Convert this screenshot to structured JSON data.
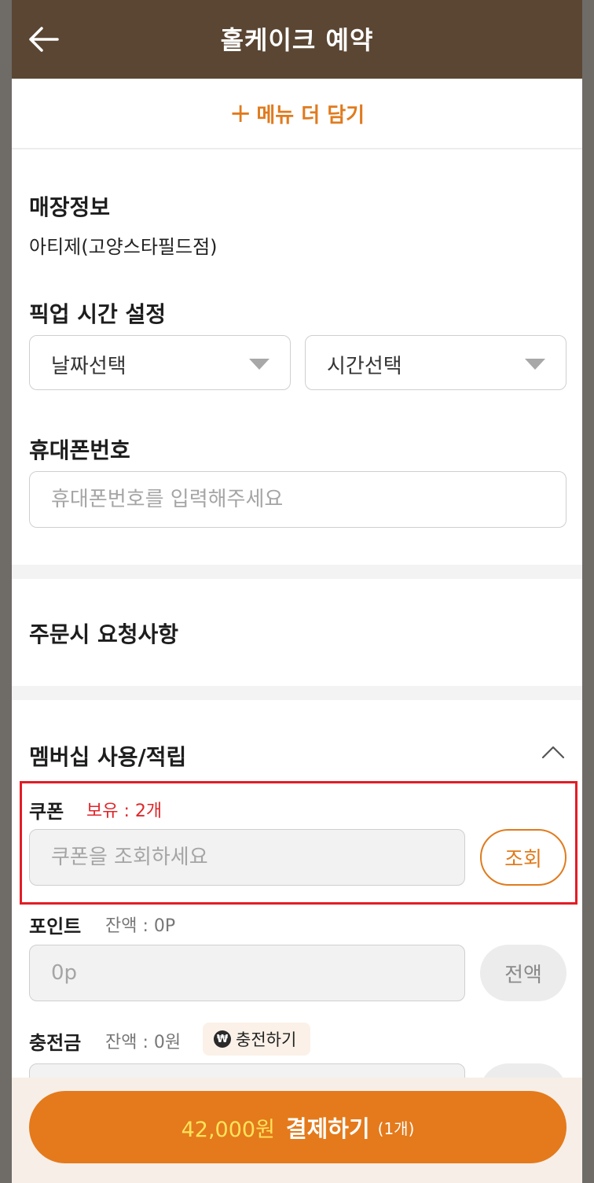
{
  "header": {
    "title": "홀케이크 예약"
  },
  "add_more": {
    "label": "메뉴 더 담기"
  },
  "store": {
    "title": "매장정보",
    "name": "아티제(고양스타필드점)"
  },
  "pickup": {
    "title": "픽업 시간 설정",
    "date_label": "날짜선택",
    "time_label": "시간선택"
  },
  "phone": {
    "title": "휴대폰번호",
    "placeholder": "휴대폰번호를 입력해주세요"
  },
  "request": {
    "title": "주문시 요청사항"
  },
  "membership": {
    "title": "멤버십 사용/적립"
  },
  "coupon": {
    "label": "쿠폰",
    "holding": "보유 : 2개",
    "placeholder": "쿠폰을 조회하세요",
    "button": "조회"
  },
  "point": {
    "label": "포인트",
    "balance": "잔액 : 0P",
    "placeholder": "0p",
    "button": "전액"
  },
  "charge": {
    "label": "충전금",
    "balance": "잔액 : 0원",
    "chip": "충전하기",
    "chip_icon_glyph": "₩"
  },
  "payment": {
    "amount": "42,000원",
    "action": "결제하기",
    "count": "(1개)"
  },
  "colors": {
    "brand_brown": "#5a4633",
    "accent_orange": "#e47a1b",
    "highlight_red": "#e21d25"
  }
}
